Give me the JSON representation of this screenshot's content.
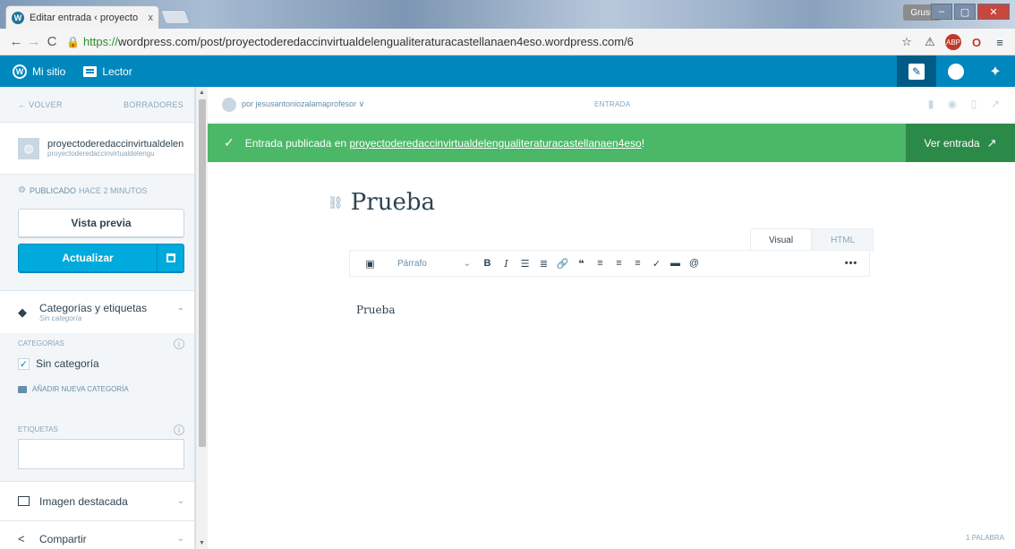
{
  "browser": {
    "tab_title": "Editar entrada ‹ proyecto",
    "tab_close": "x",
    "user_badge": "Gruss",
    "url_https": "https://",
    "url_rest": "wordpress.com/post/proyectoderedaccinvirtualdelengualiteraturacastellanaen4eso.wordpress.com/6"
  },
  "masterbar": {
    "my_site": "Mi sitio",
    "reader": "Lector"
  },
  "sidebar": {
    "back": "← VOLVER",
    "drafts": "BORRADORES",
    "site_name": "proyectoderedaccinvirtualdelen",
    "site_url": "proyectoderedaccinvirtualdelengu",
    "status_label": "PUBLICADO",
    "status_time": "HACE 2 MINUTOS",
    "preview_label": "Vista previa",
    "update_label": "Actualizar",
    "cats_title": "Categorías y etiquetas",
    "cats_sub": "Sin categoría",
    "categories_label": "CATEGORÍAS",
    "category_item": "Sin categoría",
    "add_category": "AÑADIR NUEVA CATEGORÍA",
    "tags_label": "ETIQUETAS",
    "featured_image": "Imagen destacada",
    "share": "Compartir"
  },
  "main": {
    "author": "por jesusantoniozalamaprofesor ∨",
    "entry_tag": "ENTRADA",
    "notice_prefix": "Entrada publicada en ",
    "notice_link": "proyectoderedaccinvirtualdelengualiteraturacastellanaen4eso",
    "notice_suffix": "!",
    "view_entry": "Ver entrada",
    "title": "Prueba",
    "tab_visual": "Visual",
    "tab_html": "HTML",
    "format_select": "Párrafo",
    "content": "Prueba",
    "word_count": "1 PALABRA"
  },
  "colors": {
    "masterbar": "#0087be",
    "notice": "#4ab866",
    "update_button": "#00aadc"
  }
}
